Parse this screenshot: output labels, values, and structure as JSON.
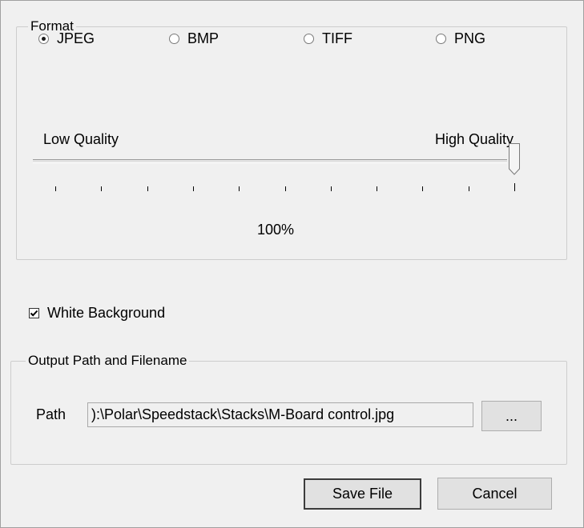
{
  "format": {
    "legend": "Format",
    "options": [
      {
        "label": "JPEG",
        "checked": true
      },
      {
        "label": "BMP",
        "checked": false
      },
      {
        "label": "TIFF",
        "checked": false
      },
      {
        "label": "PNG",
        "checked": false
      }
    ],
    "quality": {
      "low_label": "Low Quality",
      "high_label": "High Quality",
      "value_text": "100%",
      "value": 100,
      "min": 0,
      "max": 100
    }
  },
  "white_background": {
    "label": "White Background",
    "checked": true
  },
  "output": {
    "legend": "Output Path and Filename",
    "path_label": "Path",
    "path_value": "):\\Polar\\Speedstack\\Stacks\\M-Board control.jpg",
    "browse_label": "..."
  },
  "buttons": {
    "save": "Save File",
    "cancel": "Cancel"
  },
  "icons": {
    "radio_checked": "radio-checked-icon",
    "radio_unchecked": "radio-unchecked-icon",
    "checkbox": "checkmark-icon"
  }
}
